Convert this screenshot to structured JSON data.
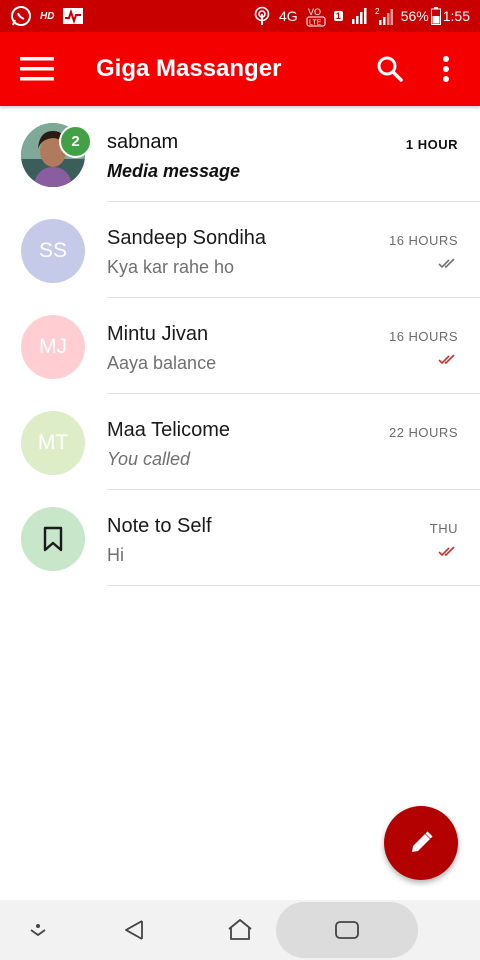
{
  "status_bar": {
    "hd": "HD",
    "network": "4G",
    "volte": "VO LTE",
    "sim1": "1",
    "sim2": "2",
    "battery": "56%",
    "time": "1:55"
  },
  "app_bar": {
    "title": "Giga Massanger"
  },
  "conversations": [
    {
      "name": "sabnam",
      "snippet": "Media message",
      "time": "1 HOUR",
      "unread_count": "2",
      "avatar_type": "photo"
    },
    {
      "name": "Sandeep Sondiha",
      "snippet": "Kya kar rahe ho",
      "time": "16 HOURS",
      "initials": "SS",
      "avatar_color": "#c5cae9",
      "check_color": "#757575"
    },
    {
      "name": "Mintu Jivan",
      "snippet": "Aaya balance",
      "time": "16 HOURS",
      "initials": "MJ",
      "avatar_color": "#ffcdd2",
      "check_color": "#d32f2f"
    },
    {
      "name": "Maa Telicome",
      "snippet": "You called",
      "time": "22 HOURS",
      "initials": "MT",
      "avatar_color": "#dcedc8"
    },
    {
      "name": "Note to Self",
      "snippet": "Hi",
      "time": "THU",
      "avatar_icon": "bookmark-icon",
      "avatar_color": "#c8e6c9",
      "check_color": "#d32f2f"
    }
  ],
  "colors": {
    "status_bar": "#c80000",
    "app_bar": "#f40000",
    "fab": "#b30000",
    "badge": "#43a047"
  },
  "fab_icon": "pencil-icon"
}
